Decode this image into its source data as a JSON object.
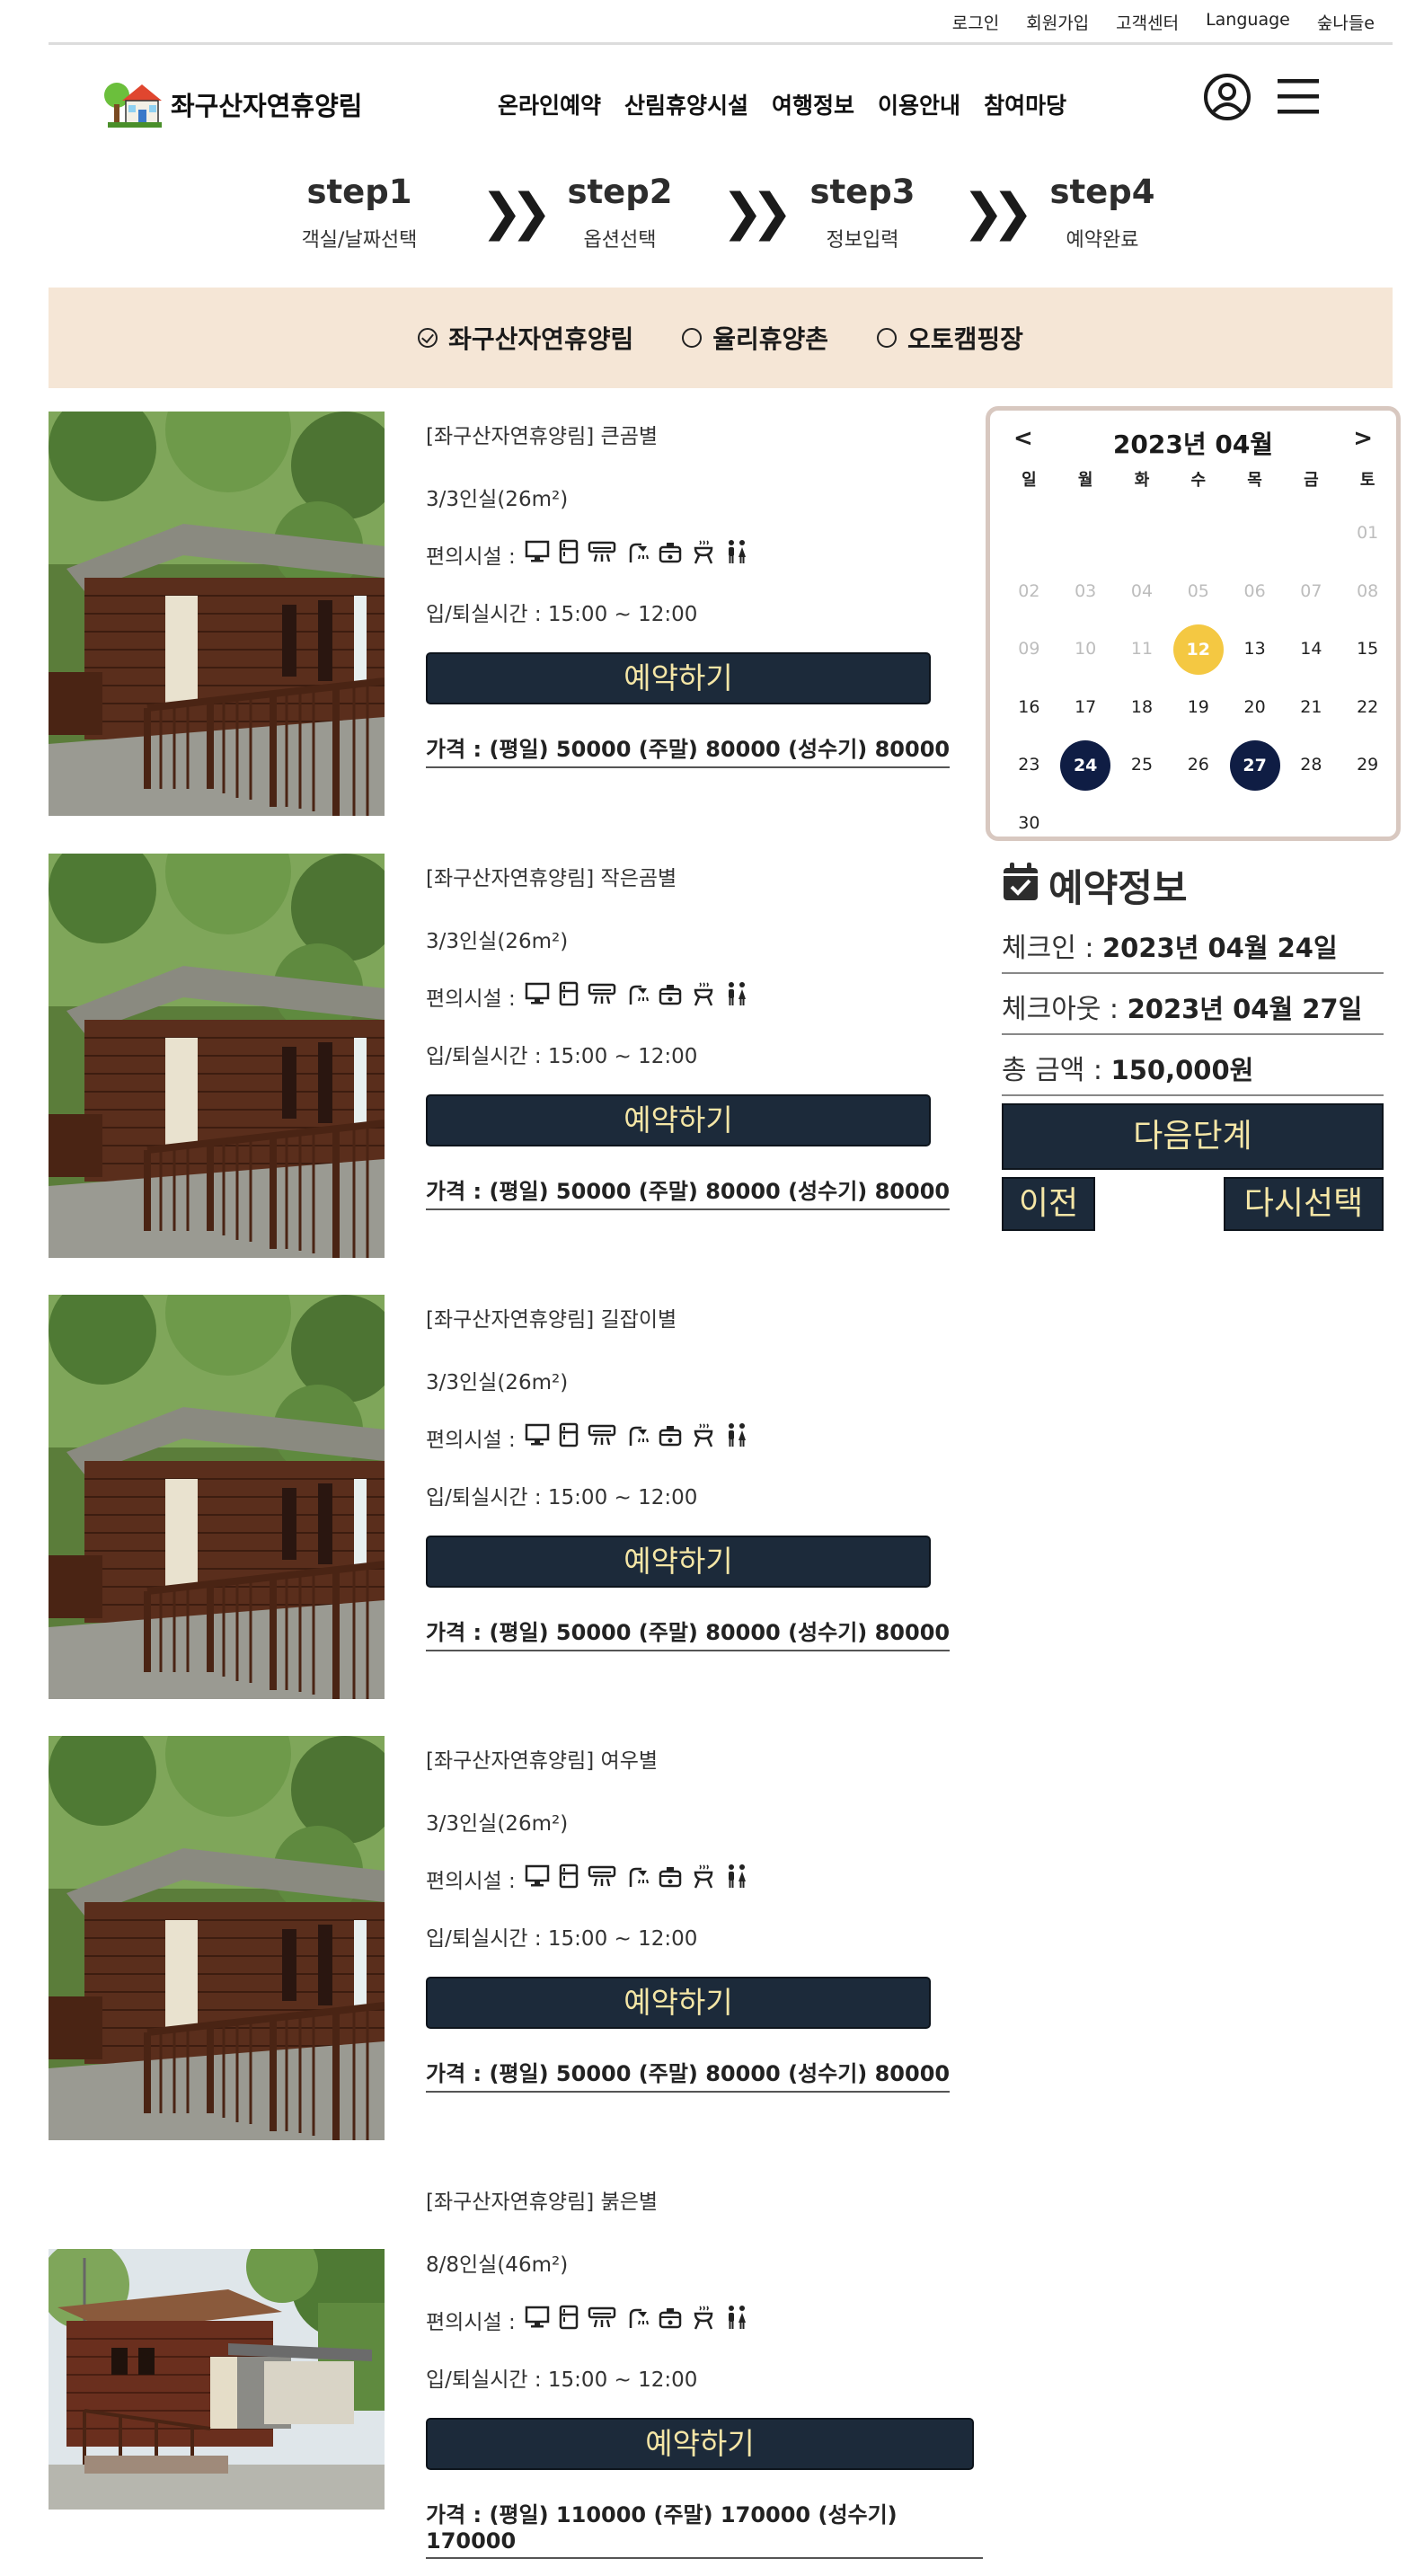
{
  "util": [
    "로그인",
    "회원가입",
    "고객센터",
    "Language",
    "숲나들e"
  ],
  "logo": {
    "text": "좌구산자연휴양림"
  },
  "nav": [
    "온라인예약",
    "산림휴양시설",
    "여행정보",
    "이용안내",
    "참여마당"
  ],
  "steps": [
    {
      "title": "step1",
      "sub": "객실/날짜선택"
    },
    {
      "title": "step2",
      "sub": "옵션선택"
    },
    {
      "title": "step3",
      "sub": "정보입력"
    },
    {
      "title": "step4",
      "sub": "예약완료"
    }
  ],
  "sites": [
    {
      "label": "좌구산자연휴양림",
      "checked": true
    },
    {
      "label": "율리휴양촌",
      "checked": false
    },
    {
      "label": "오토캠핑장",
      "checked": false
    }
  ],
  "rooms": [
    {
      "name": "[좌구산자연휴양림] 큰곰별",
      "capacity": "3/3인실(26m²)",
      "amenities_label": "편의시설 :",
      "time": "입/퇴실시간 : 15:00 ~ 12:00",
      "button": "예약하기",
      "price": "가격 : (평일) 50000 (주말) 80000 (성수기) 80000"
    },
    {
      "name": "[좌구산자연휴양림] 작은곰별",
      "capacity": "3/3인실(26m²)",
      "amenities_label": "편의시설 :",
      "time": "입/퇴실시간 : 15:00 ~ 12:00",
      "button": "예약하기",
      "price": "가격 : (평일) 50000 (주말) 80000 (성수기) 80000"
    },
    {
      "name": "[좌구산자연휴양림] 길잡이별",
      "capacity": "3/3인실(26m²)",
      "amenities_label": "편의시설 :",
      "time": "입/퇴실시간 : 15:00 ~ 12:00",
      "button": "예약하기",
      "price": "가격 : (평일) 50000 (주말) 80000 (성수기) 80000"
    },
    {
      "name": "[좌구산자연휴양림] 여우별",
      "capacity": "3/3인실(26m²)",
      "amenities_label": "편의시설 :",
      "time": "입/퇴실시간 : 15:00 ~ 12:00",
      "button": "예약하기",
      "price": "가격 : (평일) 50000 (주말) 80000 (성수기) 80000"
    },
    {
      "name": "[좌구산자연휴양림] 붉은별",
      "capacity": "8/8인실(46m²)",
      "amenities_label": "편의시설 :",
      "time": "입/퇴실시간 : 15:00 ~ 12:00",
      "button": "예약하기",
      "price": "가격 : (평일) 110000 (주말) 170000 (성수기) 170000"
    }
  ],
  "calendar": {
    "prev": "<",
    "next": ">",
    "title": "2023년 04월",
    "dow": [
      "일",
      "월",
      "화",
      "수",
      "목",
      "금",
      "토"
    ],
    "days": [
      "01",
      "02",
      "03",
      "04",
      "05",
      "06",
      "07",
      "08",
      "09",
      "10",
      "11",
      "12",
      "13",
      "14",
      "15",
      "16",
      "17",
      "18",
      "19",
      "20",
      "21",
      "22",
      "23",
      "24",
      "25",
      "26",
      "27",
      "28",
      "29",
      "30"
    ],
    "today": "12",
    "selected": [
      "24",
      "27"
    ],
    "colors": {
      "today": "#f4c842",
      "selected": "#0f1d44"
    }
  },
  "reservation": {
    "title": "예약정보",
    "checkin_label": "체크인 :",
    "checkin_value": "2023년 04월 24일",
    "checkout_label": "체크아웃 :",
    "checkout_value": "2023년 04월 27일",
    "total_label": "총 금액 :",
    "total_value": "150,000원",
    "next_button": "다음단계",
    "prev_button": "이전",
    "reset_button": "다시선택"
  },
  "colors": {
    "accent": "#1c2a3a",
    "button_text": "#f5e6a6",
    "band": "#f5e6d6"
  }
}
